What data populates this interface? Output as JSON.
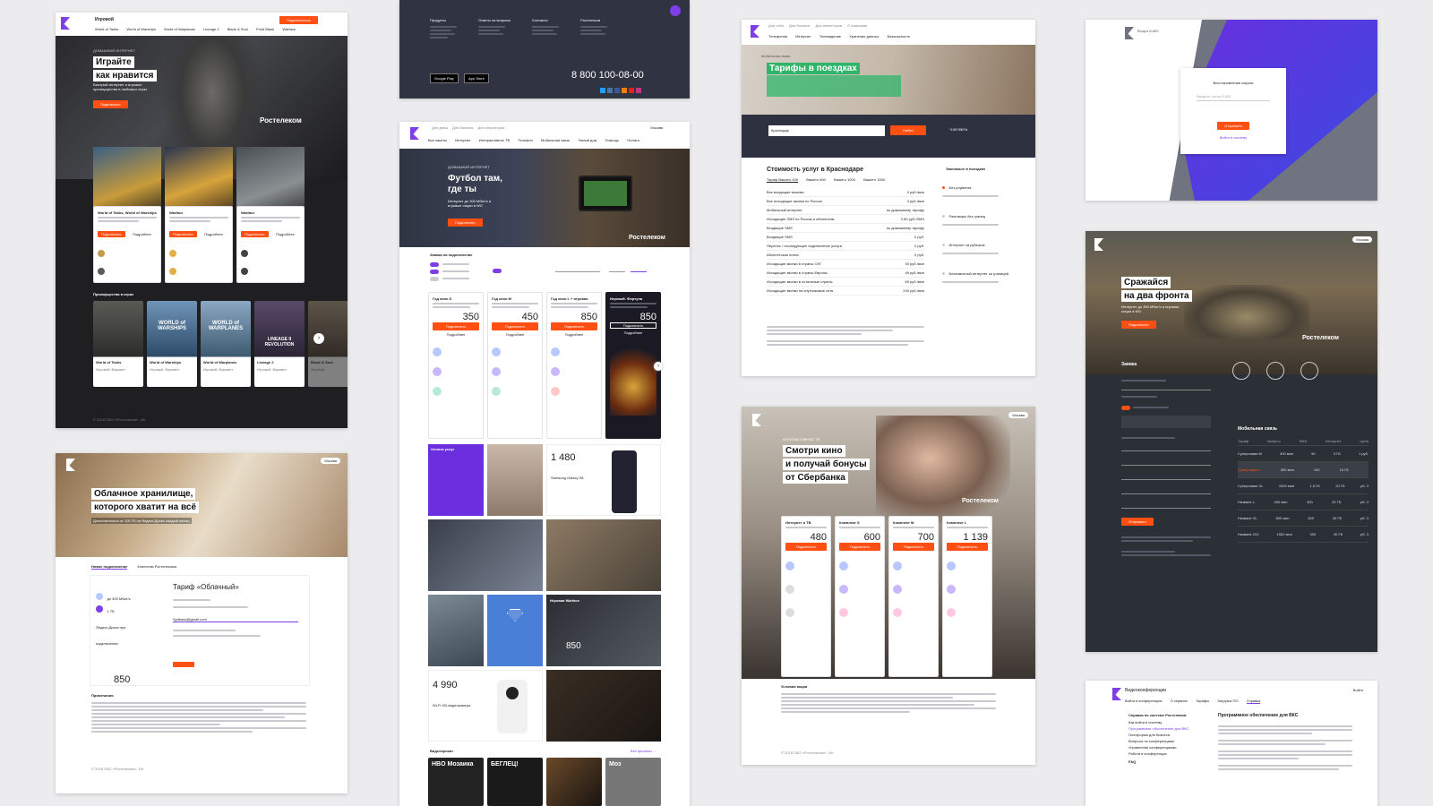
{
  "games": {
    "header_title": "Игровой",
    "nav": [
      "World of Tanks",
      "World of Warships",
      "World of Warplanes",
      "Lineage 2",
      "Blade & Soul",
      "Point Blank",
      "Warface"
    ],
    "cta": "Подключиться",
    "hero_kicker": "ДОМАШНИЙ ИНТЕРНЕТ",
    "hero_title_1": "Играйте",
    "hero_title_2": "как нравится",
    "hero_sub": "Быстрый интернет и игровые преимущества в любимых играх",
    "hero_btn": "Подключить",
    "brand": "Ростелеком",
    "cards": [
      {
        "title": "World of Tanks, World of Warships"
      },
      {
        "title": "Warface"
      },
      {
        "title": "Warface"
      }
    ],
    "card_btn": "Подключить",
    "card_more": "Подробнее",
    "advantages_title": "Преимущества в играх",
    "advantages": [
      {
        "name": "World of Tanks",
        "sub": "Игровой: Вариант"
      },
      {
        "name": "World of Warships",
        "sub": "Игровой: Вариант"
      },
      {
        "name": "World of Warplanes",
        "sub": "Игровой: Вариант"
      },
      {
        "name": "Lineage 2",
        "sub": "Игровой: Вариант"
      },
      {
        "name": "Blade & Soul",
        "sub": "Игровой"
      }
    ],
    "poster_labels": [
      "WORLD of WARSHIPS",
      "WORLD of WARPLANES",
      "LINEAGE II REVOLUTION"
    ],
    "footer": "© 2018 ПАО «Ростелеком», 18+"
  },
  "footer_card": {
    "cols": [
      "Продукты",
      "Ответы на вопросы",
      "Контакты",
      "Ростелеком"
    ],
    "phone": "8 800 100-08-00",
    "google": "Google Play",
    "apple": "App Store"
  },
  "main": {
    "topnav": [
      "Для дома",
      "Для бизнеса",
      "Для операторов"
    ],
    "topright": "Москва",
    "nav": [
      "Все пакеты",
      "Интернет",
      "Интерактивное ТВ",
      "Телефон",
      "Мобильная связь",
      "Умный дом",
      "Помощь",
      "Оплата"
    ],
    "hero_kicker": "ДОМАШНИЙ ИНТЕРНЕТ",
    "hero_title_1": "Футбол там,",
    "hero_title_2": "где ты",
    "hero_sub": "Интернет до 300 Мбит/с и игровые опции в WG",
    "hero_btn": "Подключить",
    "brand": "Ростелеком",
    "request_title": "Заявка на подключение",
    "tariffs": [
      {
        "name": "Год кино S",
        "price": "350"
      },
      {
        "name": "Год кино M",
        "price": "450"
      },
      {
        "name": "Год кино L + игровая",
        "price": "850"
      },
      {
        "name": "Игровой. Фортуна",
        "price": "850"
      }
    ],
    "tariff_btn": "Подключить",
    "tariff_more": "Подробнее",
    "purple_tile": "Оплата услуг",
    "price_1480": "1 480",
    "tile_phone": "Samsung Galaxy S8",
    "tile_warface": "Игровая Warface",
    "price_850b": "850",
    "price_4990": "4 990",
    "camera": "Wi-Fi HD-видеокамера",
    "video_title": "Видеопрокат",
    "video_all": "Все фильмы →",
    "video_posters": [
      "HBO Мозаика",
      "БЕГЛЕЦ!",
      "",
      "Моз"
    ]
  },
  "cloud": {
    "hero_title_1": "Облачное хранилище,",
    "hero_title_2": "которого хватит на всё",
    "hero_sub": "Дополнительно от 100 ГБ на Яндекс.Диске каждый месяц",
    "badge": "Москва",
    "tabs": [
      "Новое подключение",
      "Клиентам Ростелекома"
    ],
    "tariff_title": "Тариф «Облачный»",
    "speed": "до 300 Мбит/с",
    "storage": "1 ТБ Яндекс.Диска при подключении",
    "price": "850",
    "email": "Sydbasd@gmail.com",
    "notes_title": "Примечания",
    "footer": "© 2018 ПАО «Ростелеком», 18+"
  },
  "travel": {
    "nav_top": [
      "Для себя",
      "Для бизнеса",
      "Для инвесторов",
      "О компании"
    ],
    "nav": [
      "Телефония",
      "Интернет",
      "Телевидение",
      "Хранение данных",
      "Безопасность"
    ],
    "crumb": "Мобильная связь",
    "title": "Тарифы в поездках",
    "search_placeholder": "Краснодар",
    "search_btn": "Найти",
    "phone": "*100*350*#",
    "section_title": "Стоимость услуг в Краснодаре",
    "tabs": [
      "Тариф Вашего 400",
      "Вашего 600",
      "Вашего 1000",
      "Вашего 1500"
    ],
    "rows": [
      [
        "Все входящие вызовы",
        "0 руб./мин"
      ],
      [
        "Все исходящие звонки по России",
        "0 руб./мин"
      ],
      [
        "Мобильный интернет",
        "по домашнему тарифу"
      ],
      [
        "Исходящие SMS по России и абонентам",
        "2,50 руб./SMS"
      ],
      [
        "Входящие SMS",
        "по домашнему тарифу"
      ],
      [
        "Входящие SMS",
        "0 руб."
      ],
      [
        "Перенос / последующее подключение услуги",
        "0 руб."
      ],
      [
        "Абонентская плата",
        "0 руб."
      ],
      [
        "Исходящие звонки в страны СНГ",
        "30 руб./мин"
      ],
      [
        "Исходящие звонки в страны Европы",
        "49 руб./мин"
      ],
      [
        "Исходящие звонки в остальные страны",
        "69 руб./мин"
      ],
      [
        "Исходящие звонки на спутниковые сети",
        "240 руб./мин"
      ]
    ],
    "side_title": "Экономьте в поездках",
    "side_items": [
      "Без роуминга",
      "Разговоры без границ",
      "Интернет за рубежом",
      "Безлимитный интернет за границей"
    ]
  },
  "kino": {
    "badge": "Москва",
    "kicker": "ИНТЕРАКТИВНОЕ ТВ",
    "title_1": "Смотри кино",
    "title_2": "и получай бонусы",
    "title_3": "от Сбербанка",
    "brand": "Ростелеком",
    "tariffs": [
      {
        "name": "Интернет и ТВ",
        "price": "480"
      },
      {
        "name": "Комплект S",
        "price": "600"
      },
      {
        "name": "Комплект M",
        "price": "700"
      },
      {
        "name": "Комплект L",
        "price": "1 139"
      }
    ],
    "btn": "Подключить",
    "conditions": "Условия акции",
    "footer": "© 2018 ПАО «Ростелеком», 18+"
  },
  "password": {
    "brand": "Вход в 8-800",
    "title": "Восстановление пароля",
    "placeholder": "Введите логин 8-800",
    "btn": "Отправить",
    "link": "Войти в систему"
  },
  "tanks": {
    "badge": "Москва",
    "title_1": "Сражайся",
    "title_2": "на два фронта",
    "sub": "Интернет до 300 Мбит/с и игровые опции в WG",
    "btn": "Подключить",
    "brand": "Ростелеком",
    "request": "Заявка",
    "mobile_title": "Мобильная связь",
    "table_head": [
      "Тариф",
      "Минуты",
      "SMS",
      "Интернет",
      "Цена"
    ],
    "table_rows": [
      [
        "Суперновая M",
        "300 мин",
        "50",
        "3 ГБ",
        "1 руб."
      ],
      [
        "Суперновая L",
        "500 мин",
        "100",
        "10 ГБ",
        "",
        "x"
      ],
      [
        "Суперновая XL",
        "1000 мин",
        "1,5 ГБ",
        "20 ГБ",
        "рб. 3"
      ],
      [
        "Назване L",
        "400 мин",
        "300",
        "30 ГБ",
        "рб. 3"
      ],
      [
        "Назване XL",
        "800 мин",
        "300",
        "30 ГБ",
        "рб. 3"
      ],
      [
        "Назване 2XL",
        "1500 мин",
        "300",
        "30 ГБ",
        "рб. 3"
      ]
    ],
    "submit": "Отправить"
  },
  "vks": {
    "brand": "Видеоконференции",
    "nav": [
      "Войти в конференцию",
      "О сервисе",
      "Тарифы",
      "Загрузка ПО",
      "Справка"
    ],
    "side_title": "Справка по системе Ростелеком",
    "side_items": [
      "Как войти в систему",
      "Программное обеспечение для ВКС",
      "Платформа для бизнеса",
      "Вопросы по конференциям",
      "Управление конференциями",
      "Работа в конференции",
      "FAQ"
    ],
    "title": "Программное обеспечение для ВКС",
    "topright": "Войти"
  },
  "colors": {
    "purple": "#7f3fe8",
    "orange": "#ff4f12",
    "dark_navy": "#2d3140",
    "blue_tile": "#4a7fd8"
  }
}
